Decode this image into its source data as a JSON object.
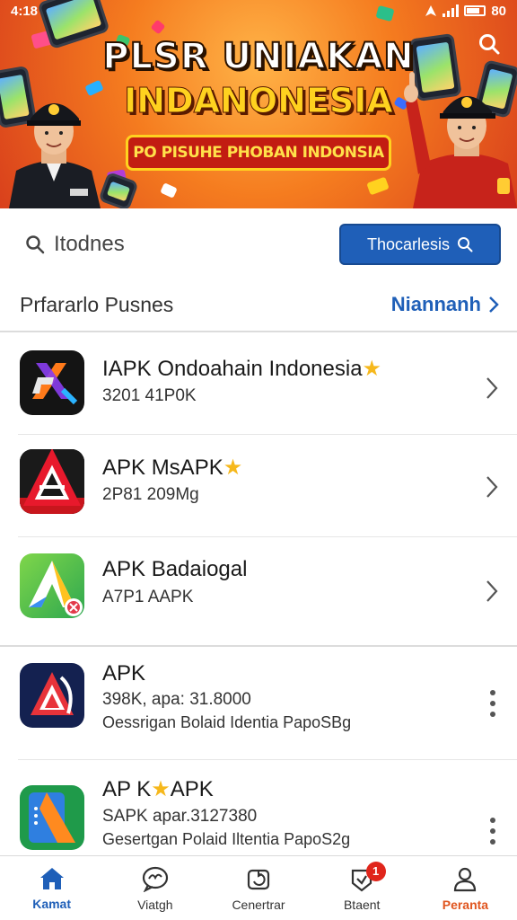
{
  "status_bar": {
    "time": "4:18",
    "battery_text": "80"
  },
  "banner": {
    "title_line1": "PLSR UNIAKAN",
    "title_line2": "INDANONESIA",
    "tagline": "PO PISUHE PHOBAN INDONSIA"
  },
  "search": {
    "input_value": "Itodnes",
    "button_label": "Thocarlesis"
  },
  "section": {
    "title": "Prfararlo Pusnes",
    "more_label": "Niannanh"
  },
  "apps": [
    {
      "name": "IAPK Ondoahain Indonesia",
      "star": "★",
      "meta": "3201 41P0K"
    },
    {
      "name": "APK MsAPK",
      "star": "★",
      "meta": "2P81 209Mg"
    },
    {
      "name": "APK Badaiogal",
      "star": "",
      "meta": "A7P1 AAPK"
    },
    {
      "name": "APK",
      "star": "",
      "meta": "398K, apa: 31.8000",
      "desc": "Oessrigan Bolaid Identia PapoSBg"
    },
    {
      "name": "AP K",
      "star": "★",
      "name_suffix": "APK",
      "meta": "SAPK apar.3127380",
      "desc": "Gesertgan Polaid Iltentia PapoS2g"
    }
  ],
  "bottom_nav": [
    {
      "label": "Kamat",
      "icon": "home-icon"
    },
    {
      "label": "Viatgh",
      "icon": "chat-icon"
    },
    {
      "label": "Cenertrar",
      "icon": "refresh-icon"
    },
    {
      "label": "Btaent",
      "icon": "download-icon",
      "badge": "1"
    },
    {
      "label": "Peranta",
      "icon": "user-icon"
    }
  ],
  "colors": {
    "accent": "#1f5fb8",
    "banner": "#f57c1f",
    "badge": "#e0251b",
    "profile": "#e0551f"
  }
}
